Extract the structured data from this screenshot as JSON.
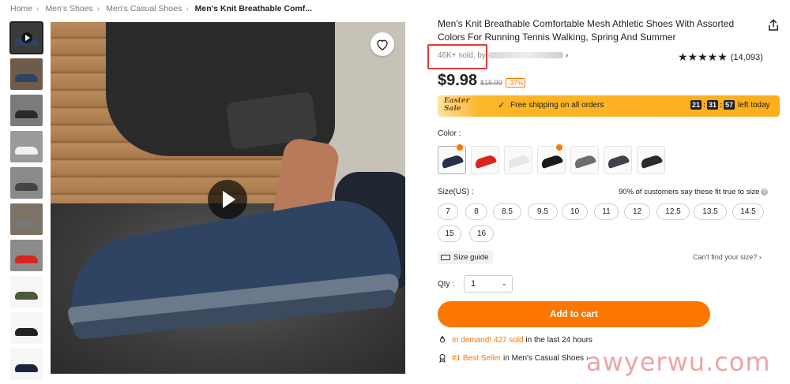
{
  "breadcrumb": [
    "Home",
    "Men's Shoes",
    "Men's Casual Shoes",
    "Men's Knit Breathable Comf..."
  ],
  "product": {
    "title": "Men's Knit Breathable Comfortable Mesh Athletic Shoes With Assorted Colors For Running Tennis Walking, Spring And Summer",
    "sold_text": "46K+ sold, by",
    "rating_stars": "★★★★★",
    "rating_count": "(14,093)",
    "price": "$9.98",
    "original_price": "$15.99",
    "discount": "-37%"
  },
  "banner": {
    "event_label": "Easter Sale",
    "shipping": "Free shipping on all orders",
    "timer_hours": "21",
    "timer_minutes": "31",
    "timer_seconds": "57",
    "timer_suffix": "left today"
  },
  "color": {
    "label": "Color :",
    "swatches": [
      {
        "name": "navy",
        "color": "#25324a",
        "hot": true
      },
      {
        "name": "red",
        "color": "#d8261f",
        "hot": false
      },
      {
        "name": "white",
        "color": "#e6e6e6",
        "hot": false
      },
      {
        "name": "black",
        "color": "#1c1c1c",
        "hot": true
      },
      {
        "name": "grey",
        "color": "#6d6d6d",
        "hot": false
      },
      {
        "name": "dark-grey",
        "color": "#3f4248",
        "hot": false
      },
      {
        "name": "black-white",
        "color": "#2a2a2a",
        "hot": false
      }
    ]
  },
  "size": {
    "label": "Size(US) :",
    "fit_text": "90% of customers say these fit true to size",
    "options": [
      "7",
      "8",
      "8.5",
      "9.5",
      "10",
      "11",
      "12",
      "12.5",
      "13.5",
      "14.5",
      "15",
      "16"
    ],
    "guide": "Size guide",
    "cant_find": "Can't find your size?"
  },
  "quantity": {
    "label": "Qty :",
    "value": "1"
  },
  "cta": {
    "add_to_cart": "Add to cart"
  },
  "demand": {
    "highlight": "In demand! 427 sold",
    "rest": "in the last 24 hours"
  },
  "bestseller": {
    "highlight": "#1 Best Seller",
    "rest": "in Men's Casual Shoes"
  },
  "watermark": "awyerwu.com",
  "colors": {
    "accent": "#fb7701",
    "highlight_box": "#e53935"
  }
}
